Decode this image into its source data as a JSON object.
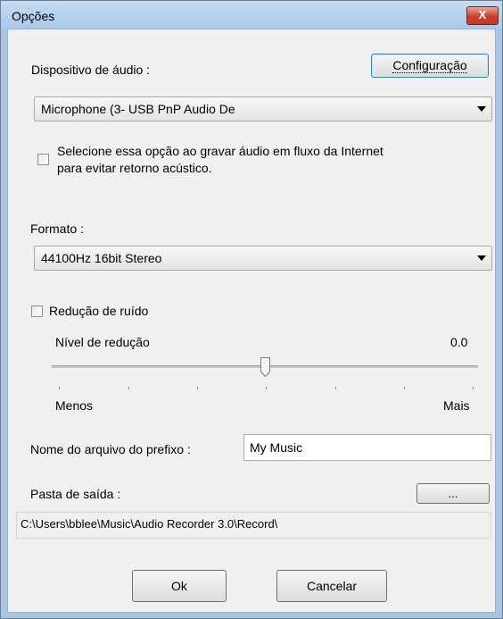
{
  "window": {
    "title": "Opções",
    "close_label": "X"
  },
  "audio_device": {
    "label": "Dispositivo de áudio :",
    "config_button": "Configuração",
    "selected": "Microphone (3- USB PnP Audio De"
  },
  "feedback_option": {
    "checked": false,
    "text_line1": "Selecione essa opção ao gravar áudio em fluxo da Internet",
    "text_line2": "para evitar retorno acústico."
  },
  "format": {
    "label": "Formato :",
    "selected": "44100Hz  16bit  Stereo"
  },
  "noise_reduction": {
    "checked": false,
    "label": "Redução de ruído",
    "level_label": "Nível de redução",
    "level_value": "0.0",
    "slider_fraction": 0.5,
    "min_label": "Menos",
    "max_label": "Mais"
  },
  "prefix": {
    "label": "Nome do arquivo do prefixo :",
    "value": "My Music"
  },
  "output": {
    "label": "Pasta de saída :",
    "browse_label": "...",
    "path": "C:\\Users\\bblee\\Music\\Audio Recorder 3.0\\Record\\"
  },
  "buttons": {
    "ok": "Ok",
    "cancel": "Cancelar"
  }
}
